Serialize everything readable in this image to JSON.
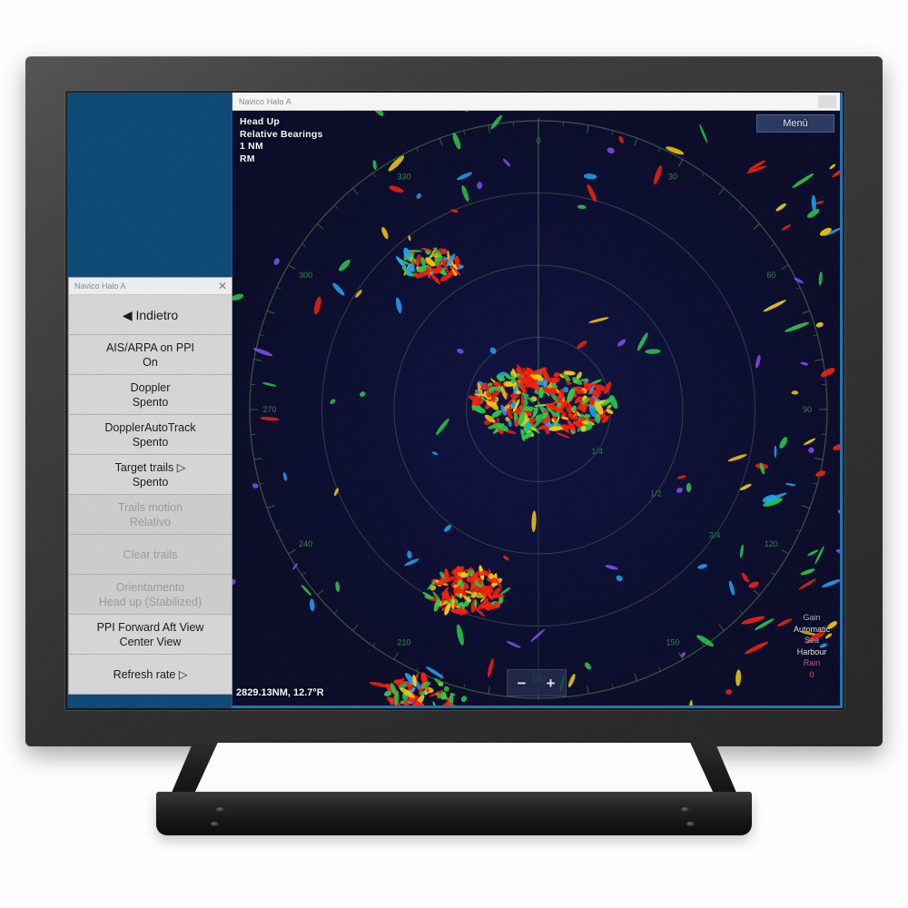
{
  "desktop": {
    "background_color": "#0b4977"
  },
  "radar_window": {
    "titlebar": {
      "title": "Navico Halo A",
      "minimize_label": ""
    },
    "hud": {
      "orientation": "Head Up",
      "bearing_mode": "Relative Bearings",
      "range": "1 NM",
      "motion_mode": "RM"
    },
    "menu_button": {
      "label": "Menù"
    },
    "cursor_readout": "2829.13NM, 12.7°R",
    "zoom_control": {
      "zoom_out": "−",
      "zoom_in": "+"
    },
    "info_panel": {
      "gain_label": "Gain",
      "gain_value": "Automatic",
      "sea_label": "Sea",
      "sea_value": "Harbour",
      "rain_label": "Rain",
      "rain_value": "0"
    },
    "ppi": {
      "bearing_labels": [
        "0",
        "30",
        "60",
        "90",
        "120",
        "150",
        "180",
        "210",
        "240",
        "270",
        "300",
        "330"
      ],
      "range_ring_labels": [
        "1/4",
        "1/2",
        "3/4"
      ],
      "ring_color": "#3d6b4a",
      "label_color": "#2f8a4e",
      "background_color": "#080a2e",
      "echo_colors": [
        "#ff1e0a",
        "#ffd400",
        "#24d14b",
        "#1fa7ff",
        "#8a4bff"
      ]
    }
  },
  "menu_panel": {
    "titlebar": {
      "title": "Navico Halo A",
      "close_label": "✕"
    },
    "items": [
      {
        "label": "◀ Indietro",
        "value": "",
        "enabled": true,
        "kind": "back"
      },
      {
        "label": "AIS/ARPA on PPI",
        "value": "On",
        "enabled": true,
        "kind": "setting"
      },
      {
        "label": "Doppler",
        "value": "Spento",
        "enabled": true,
        "kind": "setting"
      },
      {
        "label": "DopplerAutoTrack",
        "value": "Spento",
        "enabled": true,
        "kind": "setting"
      },
      {
        "label": "Target trails ▷",
        "value": "Spento",
        "enabled": true,
        "kind": "submenu"
      },
      {
        "label": "Trails motion",
        "value": "Relativo",
        "enabled": false,
        "kind": "setting"
      },
      {
        "label": "Clear trails",
        "value": "",
        "enabled": false,
        "kind": "action"
      },
      {
        "label": "Orientamento",
        "value": "Head up (Stabilized)",
        "enabled": false,
        "kind": "setting"
      },
      {
        "label": "PPI Forward Aft View",
        "value": "Center View",
        "enabled": true,
        "kind": "setting"
      },
      {
        "label": "Refresh rate ▷",
        "value": "",
        "enabled": true,
        "kind": "submenu"
      }
    ]
  }
}
